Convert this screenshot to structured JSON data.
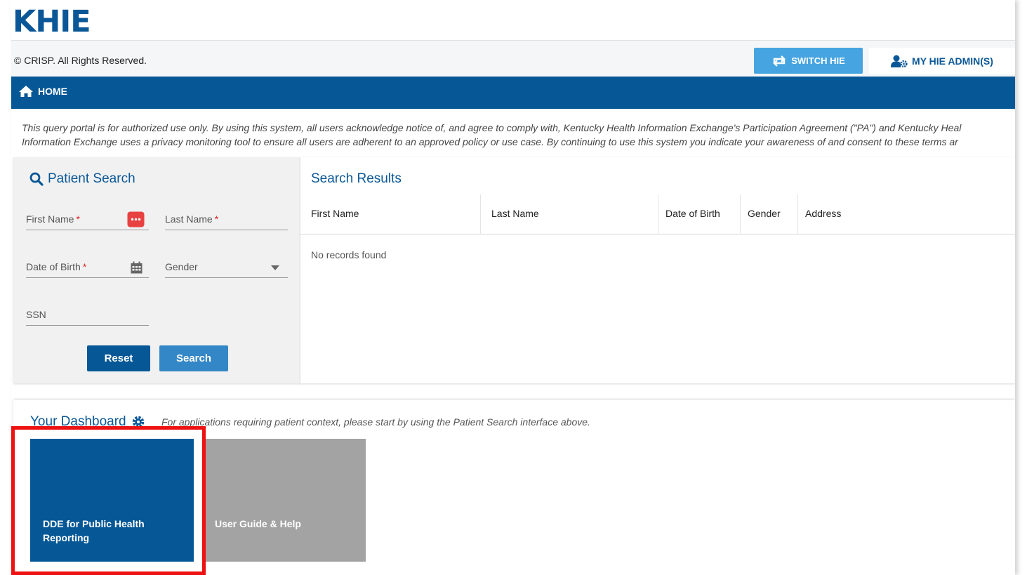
{
  "header": {
    "logo_text": "KHIE"
  },
  "topbar": {
    "copyright": "© CRISP. All Rights Reserved.",
    "switch_label": "SWITCH HIE",
    "admin_label": "MY HIE ADMIN(S)"
  },
  "nav": {
    "home_label": "HOME"
  },
  "disclaimer": {
    "line1": "This query portal is for authorized use only. By using this system, all users acknowledge notice of, and agree to comply with, Kentucky Health Information Exchange's Participation Agreement (\"PA\") and Kentucky Heal",
    "line2": "Information Exchange uses a privacy monitoring tool to ensure all users are adherent to an approved policy or use case. By continuing to use this system you indicate your awareness of and consent to these terms ar"
  },
  "patient_search": {
    "title": "Patient Search",
    "first_name_label": "First Name",
    "last_name_label": "Last Name",
    "dob_label": "Date of Birth",
    "gender_label": "Gender",
    "ssn_label": "SSN",
    "required_mark": "*",
    "reset_label": "Reset",
    "search_label": "Search"
  },
  "search_results": {
    "title": "Search Results",
    "columns": [
      "First Name",
      "Last Name",
      "Date of Birth",
      "Gender",
      "Address"
    ],
    "empty_text": "No records found"
  },
  "dashboard": {
    "title": "Your Dashboard",
    "note": "For applications requiring patient context, please start by using the Patient Search interface above.",
    "tiles": [
      {
        "label": "DDE for Public Health Reporting",
        "color": "#055796"
      },
      {
        "label": "User Guide & Help",
        "color": "#a3a3a3"
      }
    ]
  },
  "colors": {
    "brand": "#055796",
    "accent": "#46a4e0",
    "required": "#dd2222",
    "highlight": "#ee1111"
  }
}
